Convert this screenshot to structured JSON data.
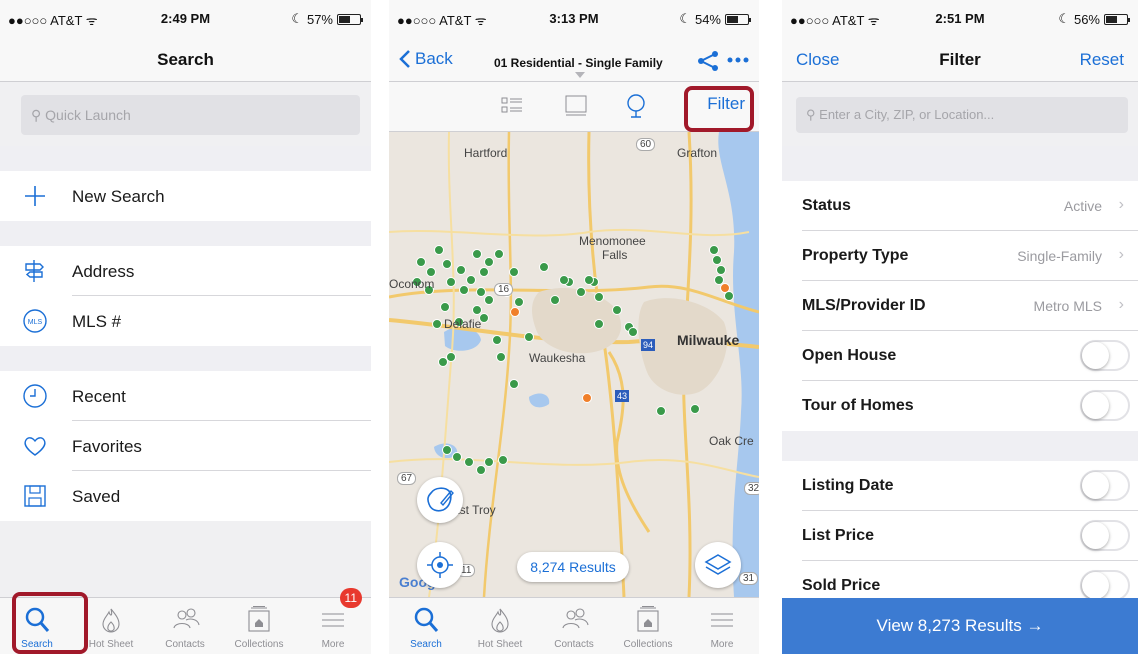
{
  "search_screen": {
    "status": {
      "carrier": "●●○○○ AT&T ᯤ",
      "time": "2:49 PM",
      "battery": "57%",
      "battery_level": 0.57
    },
    "title": "Search",
    "quick_launch_placeholder": "Quick Launch",
    "items": [
      {
        "label": "New Search",
        "icon": "plus-icon"
      },
      {
        "label": "Address",
        "icon": "signpost-icon"
      },
      {
        "label": "MLS #",
        "icon": "mls-icon",
        "icon_text": "MLS"
      },
      {
        "label": "Recent",
        "icon": "clock-icon"
      },
      {
        "label": "Favorites",
        "icon": "heart-icon"
      },
      {
        "label": "Saved",
        "icon": "save-icon"
      }
    ],
    "tabs": [
      "Search",
      "Hot Sheet",
      "Contacts",
      "Collections",
      "More"
    ],
    "more_badge": "11",
    "active_tab": "Search",
    "highlight_color": "#a1192a"
  },
  "map_screen": {
    "status": {
      "carrier": "●●○○○ AT&T ᯤ",
      "time": "3:13 PM",
      "battery": "54%",
      "battery_level": 0.54
    },
    "back_label": "Back",
    "title": "01 Residential - Single Family",
    "filter_label": "Filter",
    "map_labels": {
      "hartford": "Hartford",
      "grafton": "Grafton",
      "menomonee": "Menomonee",
      "falls": "Falls",
      "oconomowoc": "Oconom",
      "delafield": "Delafie",
      "waukesha": "Waukesha",
      "milwaukee": "Milwauke",
      "oak_creek": "Oak Cre",
      "east_troy": "ast Troy",
      "google": "Google"
    },
    "route_labels": [
      "60",
      "16",
      "94",
      "43",
      "67",
      "11",
      "32",
      "31"
    ],
    "results_label": "8,274 Results",
    "tabs": [
      "Search",
      "Hot Sheet",
      "Contacts",
      "Collections",
      "More"
    ],
    "active_tab": "Search",
    "accent": "#1b6fd6",
    "pin_color": "#3a9a4a",
    "alt_pin_color": "#f07f2a"
  },
  "filter_screen": {
    "status": {
      "carrier": "●●○○○ AT&T ᯤ",
      "time": "2:51 PM",
      "battery": "56%",
      "battery_level": 0.56
    },
    "close_label": "Close",
    "title": "Filter",
    "reset_label": "Reset",
    "location_placeholder": "Enter a City, ZIP, or Location...",
    "rows": [
      {
        "label": "Status",
        "value": "Active",
        "kind": "select"
      },
      {
        "label": "Property Type",
        "value": "Single-Family",
        "kind": "select"
      },
      {
        "label": "MLS/Provider ID",
        "value": "Metro MLS",
        "kind": "select"
      },
      {
        "label": "Open House",
        "kind": "toggle",
        "on": false
      },
      {
        "label": "Tour of Homes",
        "kind": "toggle",
        "on": false
      },
      {
        "label": "Listing Date",
        "kind": "toggle",
        "on": false
      },
      {
        "label": "List Price",
        "kind": "toggle",
        "on": false
      },
      {
        "label": "Sold Price",
        "kind": "toggle",
        "on": false
      }
    ],
    "view_results_label": "View 8,273 Results →",
    "button_color": "#3c7bd2"
  }
}
